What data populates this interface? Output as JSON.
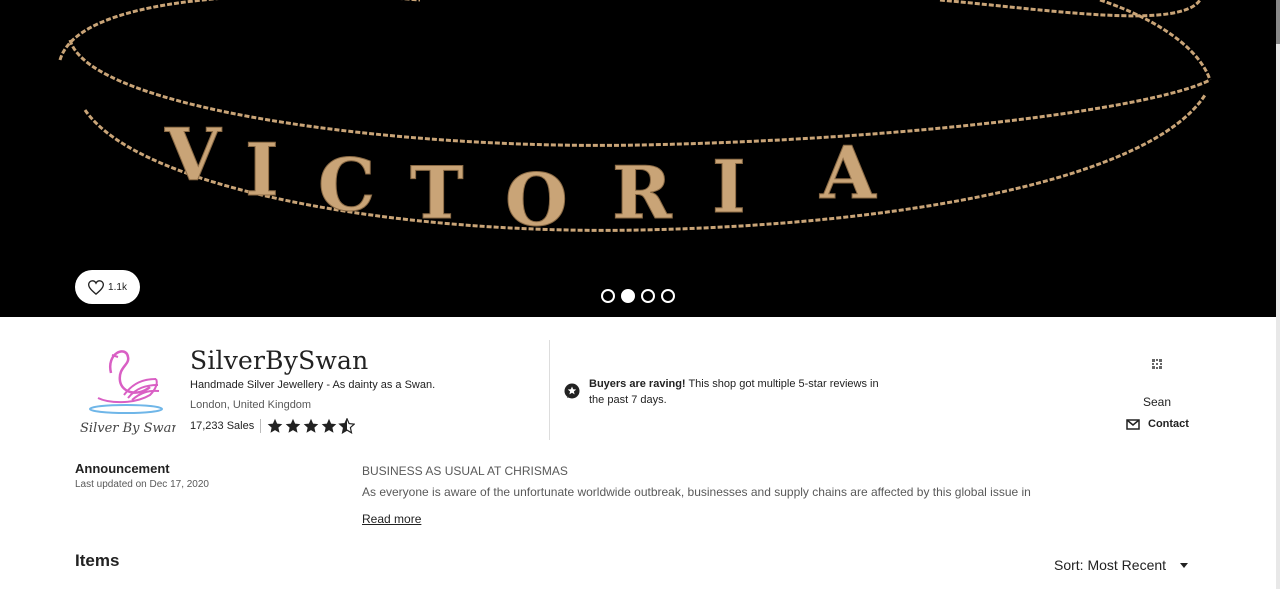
{
  "hero": {
    "banner_text": "VICTORIA",
    "favorites_count": "1.1k",
    "carousel_dots": [
      false,
      true,
      false,
      false
    ]
  },
  "shop": {
    "logo_text": "Silver By Swan",
    "name": "SilverBySwan",
    "tagline": "Handmade Silver Jewellery - As dainty as a Swan.",
    "location": "London, United Kingdom",
    "sales": "17,233 Sales",
    "rating": 4.5,
    "rave_bold": "Buyers are raving!",
    "rave_text": " This shop got multiple 5-star reviews in the past 7 days.",
    "owner_name": "Sean",
    "contact_label": "Contact"
  },
  "announcement": {
    "title": "Announcement",
    "date": "Last updated on Dec 17, 2020",
    "heading": "BUSINESS AS USUAL AT CHRISMAS",
    "body": "As everyone is aware of the unfortunate worldwide outbreak, businesses and supply chains are affected by this global issue in",
    "read_more": "Read more"
  },
  "items": {
    "title": "Items",
    "sort_label": "Sort: Most Recent"
  },
  "colors": {
    "gold": "#c9a477",
    "swan_pink": "#d95fc4",
    "swan_blue": "#6fb6e8"
  }
}
